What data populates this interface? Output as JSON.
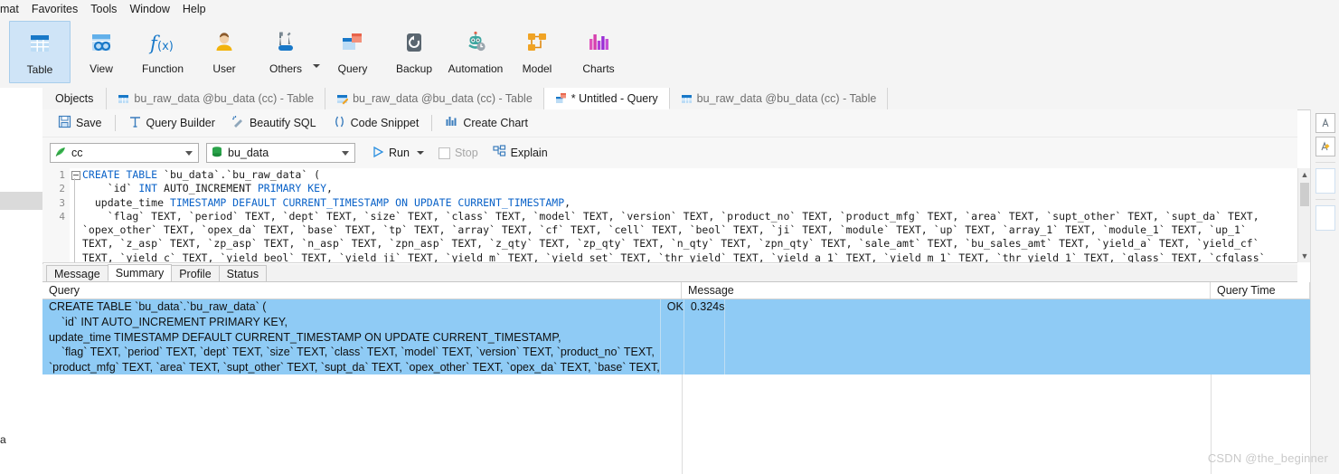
{
  "menu": {
    "items": [
      "mat",
      "Favorites",
      "Tools",
      "Window",
      "Help"
    ]
  },
  "ribbon": {
    "buttons": [
      {
        "label": "Table",
        "icon": "table-icon",
        "selected": true
      },
      {
        "label": "View",
        "icon": "view-icon",
        "selected": false
      },
      {
        "label": "Function",
        "icon": "function-icon",
        "selected": false
      },
      {
        "label": "User",
        "icon": "user-icon",
        "selected": false
      },
      {
        "label": "Others",
        "icon": "others-icon",
        "selected": false
      },
      {
        "label": "Query",
        "icon": "query-icon",
        "selected": false
      },
      {
        "label": "Backup",
        "icon": "backup-icon",
        "selected": false
      },
      {
        "label": "Automation",
        "icon": "automation-icon",
        "selected": false
      },
      {
        "label": "Model",
        "icon": "model-icon",
        "selected": false
      },
      {
        "label": "Charts",
        "icon": "charts-icon",
        "selected": false
      }
    ]
  },
  "tabstrip": {
    "objects_label": "Objects",
    "tabs": [
      {
        "label": "bu_raw_data @bu_data (cc) - Table",
        "icon": "table-tab-icon",
        "active": false
      },
      {
        "label": "bu_raw_data @bu_data (cc) - Table",
        "icon": "table-edit-tab-icon",
        "active": false
      },
      {
        "label": "* Untitled - Query",
        "icon": "query-tab-icon",
        "active": true
      },
      {
        "label": "bu_raw_data @bu_data (cc) - Table",
        "icon": "table-tab-icon",
        "active": false
      }
    ]
  },
  "query_toolbar": {
    "save": "Save",
    "query_builder": "Query Builder",
    "beautify_sql": "Beautify SQL",
    "code_snippet": "Code Snippet",
    "create_chart": "Create Chart"
  },
  "connection_row": {
    "connection": "cc",
    "database": "bu_data",
    "run": "Run",
    "stop": "Stop",
    "explain": "Explain"
  },
  "editor": {
    "line_numbers": [
      "1",
      "2",
      "3",
      "4"
    ],
    "lines": [
      [
        {
          "t": "CREATE TABLE ",
          "k": true
        },
        {
          "t": "`bu_data`.`bu_raw_data` (",
          "k": false
        }
      ],
      [
        {
          "t": "    `id` ",
          "k": false
        },
        {
          "t": "INT ",
          "k": true
        },
        {
          "t": "AUTO_INCREMENT ",
          "k": false
        },
        {
          "t": "PRIMARY KEY",
          "k": true
        },
        {
          "t": ",",
          "k": false
        }
      ],
      [
        {
          "t": "  update_time ",
          "k": false
        },
        {
          "t": "TIMESTAMP DEFAULT CURRENT_TIMESTAMP ON UPDATE CURRENT_TIMESTAMP",
          "k": true
        },
        {
          "t": ",",
          "k": false
        }
      ],
      [
        {
          "t": "    `flag` TEXT, `period` TEXT, `dept` TEXT, `size` TEXT, `class` TEXT, `model` TEXT, `version` TEXT, `product_no` TEXT, `product_mfg` TEXT, `area` TEXT, `supt_other` TEXT, `supt_da` TEXT,",
          "k": false
        }
      ],
      [
        {
          "t": "`opex_other` TEXT, `opex_da` TEXT, `base` TEXT, `tp` TEXT, `array` TEXT, `cf` TEXT, `cell` TEXT, `beol` TEXT, `ji` TEXT, `module` TEXT, `up` TEXT, `array_1` TEXT, `module_1` TEXT, `up_1`",
          "k": false
        }
      ],
      [
        {
          "t": "TEXT, `z_asp` TEXT, `zp_asp` TEXT, `n_asp` TEXT, `zpn_asp` TEXT, `z_qty` TEXT, `zp_qty` TEXT, `n_qty` TEXT, `zpn_qty` TEXT, `sale_amt` TEXT, `bu_sales_amt` TEXT, `yield_a` TEXT, `yield_cf`",
          "k": false
        }
      ],
      [
        {
          "t": "TEXT, `yield_c` TEXT, `yield_beol` TEXT, `yield_ji` TEXT, `yield_m` TEXT, `yield_set` TEXT, `thr_yield` TEXT, `yield_a_1` TEXT, `yield_m_1` TEXT, `thr_yield_1` TEXT, `glass` TEXT, `cfglass`",
          "k": false
        }
      ]
    ]
  },
  "result_tabs": {
    "tabs": [
      {
        "label": "Message",
        "active": false
      },
      {
        "label": "Summary",
        "active": true
      },
      {
        "label": "Profile",
        "active": false
      },
      {
        "label": "Status",
        "active": false
      }
    ]
  },
  "summary_grid": {
    "columns": [
      "Query",
      "Message",
      "Query Time"
    ],
    "rows": [
      {
        "query": "CREATE TABLE `bu_data`.`bu_raw_data` (\n    `id` INT AUTO_INCREMENT PRIMARY KEY,\nupdate_time TIMESTAMP DEFAULT CURRENT_TIMESTAMP ON UPDATE CURRENT_TIMESTAMP,\n    `flag` TEXT, `period` TEXT, `dept` TEXT, `size` TEXT, `class` TEXT, `model` TEXT, `version` TEXT, `product_no` TEXT,\n`product_mfg` TEXT, `area` TEXT, `supt_other` TEXT, `supt_da` TEXT, `opex_other` TEXT, `opex_da` TEXT, `base` TEXT,",
        "message": "OK",
        "query_time": "0.324s"
      }
    ]
  },
  "left_panel": {
    "stub_text": "a"
  },
  "watermark": {
    "text": "CSDN @the_beginner"
  },
  "colors": {
    "accent": "#0a62c8",
    "selection": "#8fcbf5",
    "ribbon_selected": "#cfe4f7"
  }
}
